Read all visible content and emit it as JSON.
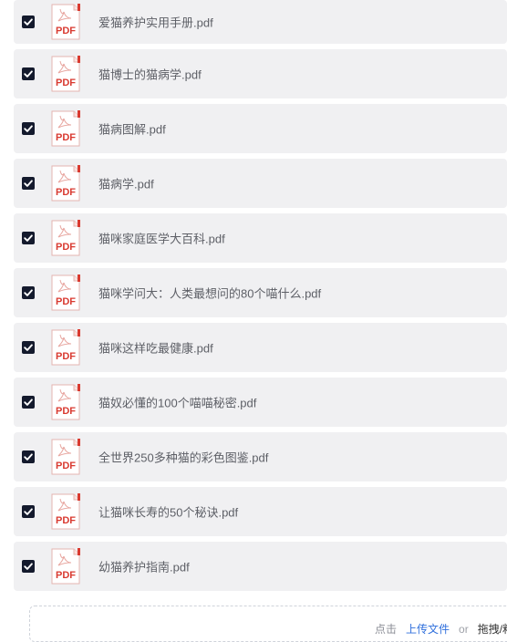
{
  "files": [
    {
      "name": "爱猫养护实用手册.pdf",
      "checked": true,
      "icon_label": "PDF"
    },
    {
      "name": "猫博士的猫病学.pdf",
      "checked": true,
      "icon_label": "PDF"
    },
    {
      "name": "猫病图解.pdf",
      "checked": true,
      "icon_label": "PDF"
    },
    {
      "name": "猫病学.pdf",
      "checked": true,
      "icon_label": "PDF"
    },
    {
      "name": "猫咪家庭医学大百科.pdf",
      "checked": true,
      "icon_label": "PDF"
    },
    {
      "name": "猫咪学问大：人类最想问的80个喵什么.pdf",
      "checked": true,
      "icon_label": "PDF"
    },
    {
      "name": "猫咪这样吃最健康.pdf",
      "checked": true,
      "icon_label": "PDF"
    },
    {
      "name": "猫奴必懂的100个喵喵秘密.pdf",
      "checked": true,
      "icon_label": "PDF"
    },
    {
      "name": "全世界250多种猫的彩色图鉴.pdf",
      "checked": true,
      "icon_label": "PDF"
    },
    {
      "name": "让猫咪长寿的50个秘诀.pdf",
      "checked": true,
      "icon_label": "PDF"
    },
    {
      "name": "幼猫养护指南.pdf",
      "checked": true,
      "icon_label": "PDF"
    }
  ],
  "upload": {
    "click_text": "点击",
    "upload_link": "上传文件",
    "or_text": "or",
    "drag_text": "拖拽/粘"
  },
  "colors": {
    "row_bg": "#f0f0f2",
    "checkbox": "#141a2d",
    "pdf_red": "#d93a30",
    "link": "#2f6fdc"
  }
}
